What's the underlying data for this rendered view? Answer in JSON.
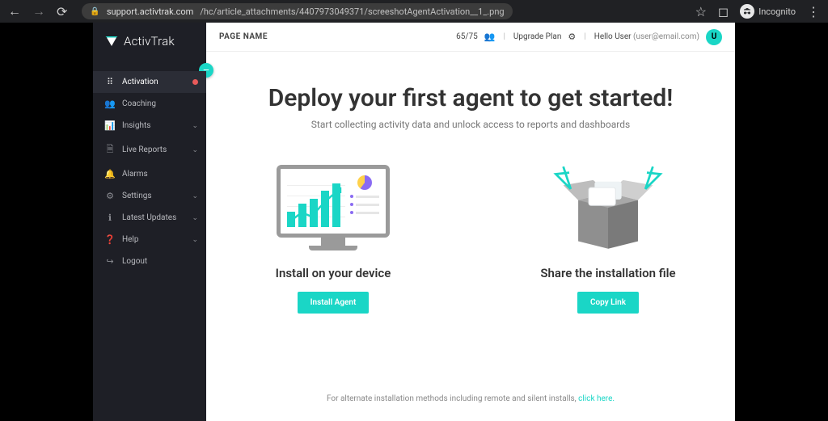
{
  "browser": {
    "url_host": "support.activtrak.com",
    "url_path": "/hc/article_attachments/4407973049371/screeshotAgentActivation__1_.png",
    "incognito_label": "Incognito"
  },
  "logo_text": "ActivTrak",
  "collapse_glyph": "–",
  "sidebar": {
    "items": [
      {
        "icon": "grid",
        "label": "Activation",
        "active": true,
        "dot": true
      },
      {
        "icon": "people",
        "label": "Coaching",
        "expandable": false
      },
      {
        "icon": "stats",
        "label": "Insights",
        "expandable": true
      },
      {
        "icon": "report",
        "label": "Live Reports",
        "expandable": true
      },
      {
        "icon": "bell",
        "label": "Alarms",
        "expandable": false
      },
      {
        "icon": "gear",
        "label": "Settings",
        "expandable": true
      },
      {
        "icon": "info",
        "label": "Latest Updates",
        "expandable": true
      },
      {
        "icon": "help",
        "label": "Help",
        "expandable": true
      },
      {
        "icon": "logout",
        "label": "Logout",
        "expandable": false
      }
    ]
  },
  "topbar": {
    "page_name": "PAGE NAME",
    "license_count": "65/75",
    "upgrade_label": "Upgrade Plan",
    "greeting": "Hello User",
    "email": "(user@email.com)",
    "avatar_letter": "U"
  },
  "hero": {
    "title": "Deploy your first agent to get started!",
    "subtitle": "Start collecting activity data and unlock access to reports and dashboards"
  },
  "cards": {
    "install": {
      "title": "Install on your device",
      "button": "Install Agent"
    },
    "share": {
      "title": "Share the installation file",
      "button": "Copy Link"
    }
  },
  "footnote": {
    "text": "For alternate installation methods including remote and silent installs, ",
    "link": "click here."
  }
}
